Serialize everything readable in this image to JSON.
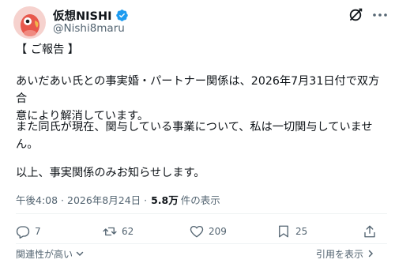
{
  "author": {
    "display_name": "仮想NISHI",
    "handle": "@Nishi8maru",
    "verified": true,
    "avatar_icon": "parrot-avatar-icon",
    "avatar_bg": "#f4c7c3",
    "avatar_fg": "#e05a4f"
  },
  "header_actions": {
    "grok_icon": "grok-icon",
    "more_icon": "more-options-icon"
  },
  "post": {
    "paragraph_1": "【 ご報告 】",
    "paragraph_2_line_1": "あいだあい氏との事実婚・パートナー関係は、2026年7月31日付で双方合",
    "paragraph_2_line_2": "意により解消しています。",
    "paragraph_3_line_1": "また同氏が現在、関与している事業について、私は一切関与していませ",
    "paragraph_3_line_2": "ん。",
    "paragraph_4": "以上、事実関係のみお知らせします。"
  },
  "meta": {
    "timestamp": "午後4:08 · 2026年8月24日 · ",
    "views_count": "5.8万",
    "views_label": "件の表示"
  },
  "actions": {
    "reply_count": "7",
    "repost_count": "62",
    "like_count": "209",
    "bookmark_count": "25"
  },
  "footer": {
    "relevance_label": "関連性が高い",
    "quotes_label": "引用を表示"
  },
  "colors": {
    "text_primary": "#0f1419",
    "text_secondary": "#536471",
    "verified_blue": "#1d9bf0",
    "divider": "#eff3f4"
  }
}
